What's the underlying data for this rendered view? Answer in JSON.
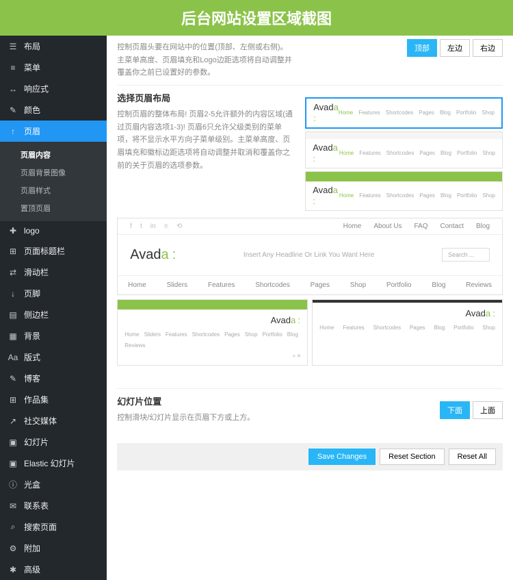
{
  "banner": "后台网站设置区域截图",
  "sidebar": {
    "items": [
      {
        "icon": "☰",
        "label": "布局"
      },
      {
        "icon": "≡",
        "label": "菜单"
      },
      {
        "icon": "↔",
        "label": "响应式"
      },
      {
        "icon": "✎",
        "label": "颜色"
      },
      {
        "icon": "↑",
        "label": "页眉",
        "active": true
      },
      {
        "icon": "✚",
        "label": "logo"
      },
      {
        "icon": "⊞",
        "label": "页面标题栏"
      },
      {
        "icon": "⇄",
        "label": "滑动栏"
      },
      {
        "icon": "↓",
        "label": "页脚"
      },
      {
        "icon": "▤",
        "label": "侧边栏"
      },
      {
        "icon": "▦",
        "label": "背景"
      },
      {
        "icon": "Aa",
        "label": "版式"
      },
      {
        "icon": "✎",
        "label": "博客"
      },
      {
        "icon": "⊞",
        "label": "作品集"
      },
      {
        "icon": "↗",
        "label": "社交媒体"
      },
      {
        "icon": "▣",
        "label": "幻灯片"
      },
      {
        "icon": "▣",
        "label": "Elastic 幻灯片"
      },
      {
        "icon": "ⓘ",
        "label": "光盒"
      },
      {
        "icon": "✉",
        "label": "联系表"
      },
      {
        "icon": "⌕",
        "label": "搜索页面"
      },
      {
        "icon": "⚙",
        "label": "附加"
      },
      {
        "icon": "✱",
        "label": "高级"
      }
    ],
    "sub": [
      {
        "label": "页眉内容",
        "active": true
      },
      {
        "label": "页眉背景图像"
      },
      {
        "label": "页眉样式"
      },
      {
        "label": "置顶页眉"
      }
    ]
  },
  "section1": {
    "desc": "控制页眉头要在网站中的位置(顶部、左侧或右侧)。主菜单高度、页眉填充和Logo边距选项将自动调整并覆盖你之前已设置好的参数。",
    "btns": [
      "顶部",
      "左边",
      "右边"
    ]
  },
  "section2": {
    "title": "选择页眉布局",
    "desc": "控制页眉的整体布局! 页眉2-5允许额外的内容区域(通过页眉内容选项1-3)! 页眉6只允许父级类别的菜单项，将不显示水平方向子菜单级别。主菜单高度、页眉填充和徽标边距选项将自动调整并取消和覆盖你之前的关于页眉的选项参数。"
  },
  "preview": {
    "logo_brand": "Avad",
    "logo_suffix": "a",
    "logo_punct": ":",
    "nav": [
      "Home",
      "Features",
      "Shortcodes",
      "Pages",
      "Blog",
      "Portfolio",
      "Shop"
    ],
    "big_nav": [
      "Home",
      "About Us",
      "FAQ",
      "Contact",
      "Blog"
    ],
    "headline": "Insert Any Headline Or Link You Want Here",
    "search": "Search ...",
    "big_menu": [
      "Home",
      "Sliders",
      "Features",
      "Shortcodes",
      "Pages",
      "Shop",
      "Portfolio",
      "Blog",
      "Reviews"
    ],
    "tc_nav": [
      "Home",
      "Sliders",
      "Features",
      "Shortcodes",
      "Pages",
      "Shop",
      "Portfolio",
      "Blog",
      "Reviews"
    ],
    "search_icon": "⌕",
    "menu_icon": "≡"
  },
  "section3": {
    "title": "幻灯片位置",
    "desc": "控制滑块/幻灯片显示在页眉下方或上方。",
    "btns": [
      "下面",
      "上面"
    ]
  },
  "footer": {
    "save": "Save Changes",
    "reset_section": "Reset Section",
    "reset_all": "Reset All"
  }
}
